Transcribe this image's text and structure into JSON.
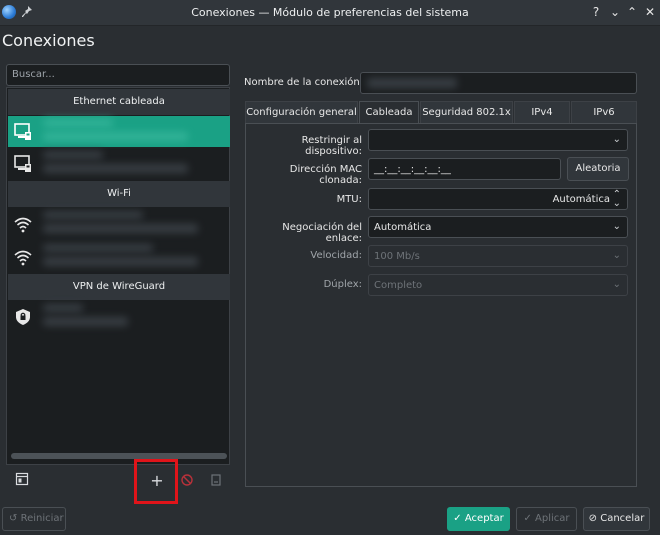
{
  "window": {
    "title": "Conexiones — Módulo de preferencias del sistema",
    "help": "?",
    "minimize": "⌄",
    "maximize": "⌃",
    "close": "✕"
  },
  "heading": "Conexiones",
  "search": {
    "placeholder": "Buscar..."
  },
  "groups": {
    "ethernet": "Ethernet cableada",
    "wifi": "Wi-Fi",
    "vpn": "VPN de WireGuard"
  },
  "form": {
    "connection_name_label": "Nombre de la conexión:",
    "tabs": [
      "Configuración general",
      "Cableada",
      "Seguridad 802.1x",
      "IPv4",
      "IPv6"
    ],
    "active_tab": "Cableada",
    "restrict_device_label": "Restringir al dispositivo:",
    "mac_label": "Dirección MAC clonada:",
    "mac_value": "__:__:__:__:__:__",
    "random_button": "Aleatoria",
    "mtu_label": "MTU:",
    "mtu_value": "Automática",
    "negotiation_label": "Negociación del enlace:",
    "negotiation_value": "Automática",
    "speed_label": "Velocidad:",
    "speed_value": "100 Mb/s",
    "duplex_label": "Dúplex:",
    "duplex_value": "Completo"
  },
  "footer": {
    "reset": "Reiniciar",
    "accept": "Aceptar",
    "apply": "Aplicar",
    "cancel": "Cancelar"
  },
  "add_icon": "+",
  "colors": {
    "accent": "#1aa185",
    "highlight": "#e0141a",
    "background": "#2a2e32"
  }
}
